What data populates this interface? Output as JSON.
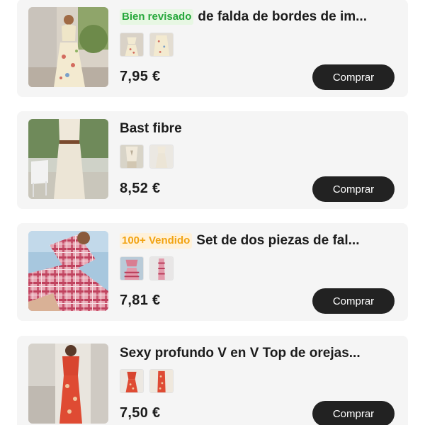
{
  "products": [
    {
      "badge": "Bien revisado",
      "badge_color": "#27a83c",
      "title": "de falda de bordes de im...",
      "price": "7,95 €",
      "buy_label": "Comprar",
      "thumbnail_count": 2
    },
    {
      "badge": "",
      "title": "Bast fibre",
      "price": "8,52 €",
      "buy_label": "Comprar",
      "thumbnail_count": 2
    },
    {
      "badge": "100+ Vendido",
      "badge_color": "#f2a312",
      "title": "Set de dos piezas de fal...",
      "price": "7,81 €",
      "buy_label": "Comprar",
      "thumbnail_count": 2
    },
    {
      "badge": "",
      "title": "Sexy profundo V en V Top de orejas...",
      "price": "7,50 €",
      "buy_label": "Comprar",
      "thumbnail_count": 2
    }
  ],
  "colors": {
    "card_background": "#f5f5f5",
    "button_background": "#222222",
    "button_text": "#ffffff"
  }
}
